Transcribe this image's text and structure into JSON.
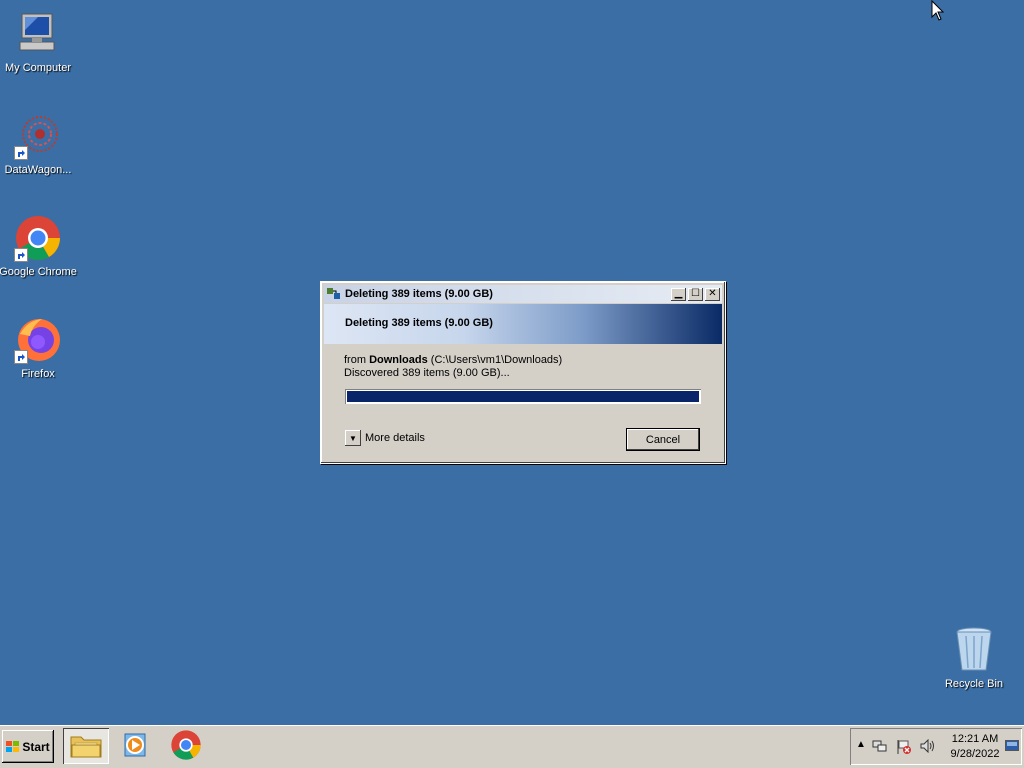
{
  "desktop": {
    "icons": [
      {
        "label": "My Computer",
        "icon": "computer-icon"
      },
      {
        "label": "DataWagon...",
        "icon": "datawagon-icon"
      },
      {
        "label": "Google Chrome",
        "icon": "chrome-icon"
      },
      {
        "label": "Firefox",
        "icon": "firefox-icon"
      },
      {
        "label": "Recycle Bin",
        "icon": "recycle-bin-icon"
      }
    ]
  },
  "dialog": {
    "title": "Deleting 389 items (9.00 GB)",
    "banner": "Deleting 389 items (9.00 GB)",
    "from_prefix": "from",
    "from_folder": "Downloads",
    "from_path": "(C:\\Users\\vm1\\Downloads)",
    "discovered": "Discovered 389 items (9.00 GB)...",
    "progress_fraction": 1.0,
    "more_details": "More details",
    "cancel": "Cancel",
    "colors": {
      "progress": "#0a246a",
      "banner_dark": "#0a2a66"
    }
  },
  "taskbar": {
    "start_label": "Start",
    "pinned": [
      "explorer-icon",
      "media-player-icon",
      "chrome-icon"
    ],
    "clock_time": "12:21 AM",
    "clock_date": "9/28/2022"
  },
  "colors": {
    "desktop": "#3a6ea5",
    "chrome_face": "#d4d0c8"
  }
}
